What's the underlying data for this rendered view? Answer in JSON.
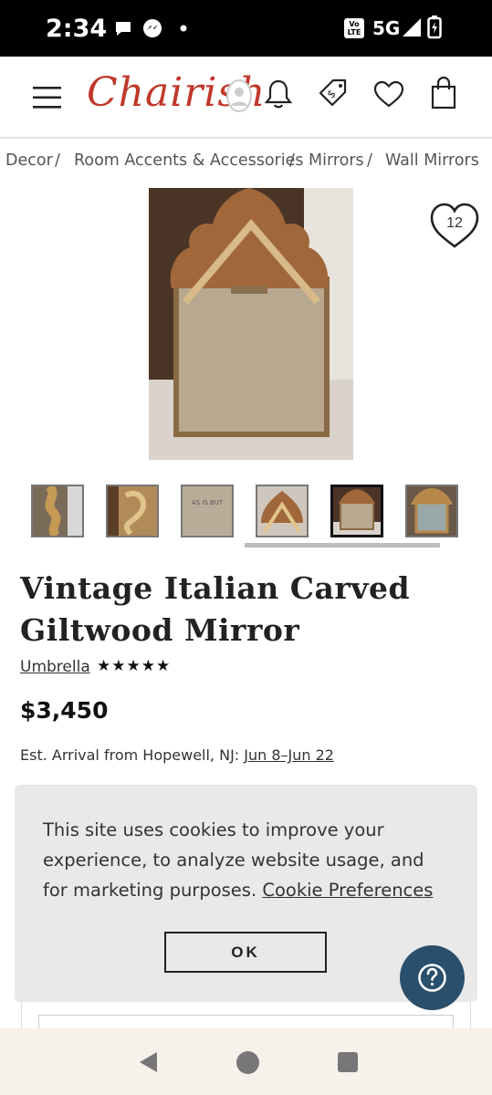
{
  "status_bar": {
    "time": "2:34",
    "network": "5G",
    "volte": "Vo LTE"
  },
  "header": {
    "logo": "Chairish"
  },
  "breadcrumbs": [
    "Decor",
    "Room Accents & Accessories",
    "Mirrors",
    "Wall Mirrors"
  ],
  "breadcrumb_separator": "/",
  "product": {
    "favorite_count": "12",
    "title": "Vintage Italian Carved Giltwood Mirror",
    "seller": "Umbrella",
    "rating_stars": "★★★★★",
    "price": "$3,450",
    "arrival_label": "Est. Arrival from Hopewell, NJ:",
    "arrival_dates": "Jun 8–Jun 22",
    "thumbnail_count": 6,
    "selected_thumbnail": 5
  },
  "cookie_banner": {
    "text": "This site uses cookies to improve your experience, to analyze website usage, and for marketing purposes.",
    "link": "Cookie Preferences",
    "ok_label": "OK"
  },
  "thumb3_text": "AS IS BUT",
  "colors": {
    "brand": "#c0392b",
    "help_button": "#2a4f6c",
    "banner_bg": "#e9e9e9"
  }
}
